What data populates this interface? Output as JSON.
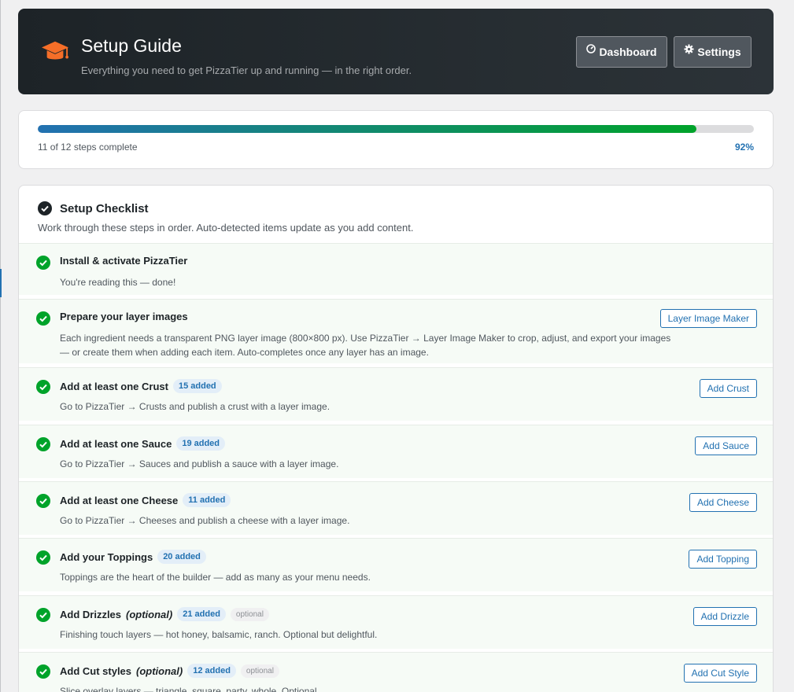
{
  "header": {
    "title": "Setup Guide",
    "subtitle": "Everything you need to get PizzaTier up and running — in the right order.",
    "icon": "graduation-cap-icon",
    "dashboard_label": "Dashboard",
    "settings_label": "Settings",
    "accent": "#f56e28"
  },
  "progress": {
    "label": "11 of 12 steps complete",
    "percent_text": "92%",
    "fraction": 0.92,
    "completed": 11,
    "total": 12
  },
  "checklist": {
    "title": "Setup Checklist",
    "subtitle": "Work through these steps in order. Auto-detected items update as you add content.",
    "steps": [
      {
        "title": "Install & activate PizzaTier",
        "desc": "You're reading this — done!",
        "status": "complete"
      },
      {
        "title": "Prepare your layer images",
        "desc_line1": "Each ingredient needs a transparent PNG layer image (800×800 px). Use PizzaTier → Layer Image Maker to crop, adjust, and export your images",
        "desc_line2": "— or create them when adding each item. Auto-completes once any layer has an image.",
        "button": "Layer Image Maker",
        "status": "complete"
      },
      {
        "title": "Add at least one Crust",
        "badge": "15 added",
        "desc": "Go to PizzaTier → Crusts and publish a crust with a layer image.",
        "button": "Add Crust",
        "status": "complete"
      },
      {
        "title": "Add at least one Sauce",
        "badge": "19 added",
        "desc": "Go to PizzaTier → Sauces and publish a sauce with a layer image.",
        "button": "Add Sauce",
        "status": "complete"
      },
      {
        "title": "Add at least one Cheese",
        "badge": "11 added",
        "desc": "Go to PizzaTier → Cheeses and publish a cheese with a layer image.",
        "button": "Add Cheese",
        "status": "complete"
      },
      {
        "title": "Add your Toppings",
        "badge": "20 added",
        "desc": "Toppings are the heart of the builder — add as many as your menu needs.",
        "button": "Add Topping",
        "status": "complete"
      },
      {
        "title": "Add Drizzles",
        "title_optional": "(optional)",
        "badge": "21 added",
        "optional_badge": "optional",
        "desc": "Finishing touch layers — hot honey, balsamic, ranch. Optional but delightful.",
        "button": "Add Drizzle",
        "status": "complete"
      },
      {
        "title": "Add Cut styles",
        "title_optional": "(optional)",
        "badge": "12 added",
        "optional_badge": "optional",
        "desc": "Slice overlay layers — triangle, square, party, whole. Optional.",
        "button": "Add Cut Style",
        "status": "complete"
      }
    ]
  },
  "colors": {
    "success": "#00a32a",
    "link": "#2271b1"
  }
}
